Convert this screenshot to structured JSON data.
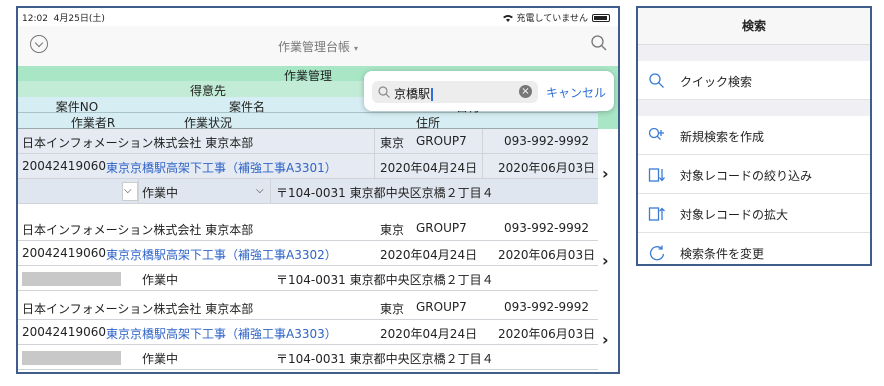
{
  "status_bar": {
    "time": "12:02",
    "date": "4月25日(土)",
    "charging": "充電していません"
  },
  "navbar": {
    "title": "作業管理台帳",
    "title_caret": "▾"
  },
  "table_header": {
    "group": "作業管理",
    "customer": "得意先",
    "case_no": "案件NO",
    "case_name": "案件名",
    "date": "日付",
    "worker": "作業者R",
    "work_status": "作業状況",
    "address": "住所"
  },
  "records": [
    {
      "customer": "日本インフォメーション株式会社 東京本部",
      "region": "東京",
      "group": "GROUP7",
      "phone": "093-992-9992",
      "case_no": "20042419060",
      "case_name": "東京京橋駅高架下工事（補強工事A3301）",
      "start_date": "2020年04月24日",
      "end_date": "2020年06月03日",
      "status": "作業中",
      "address": "〒104-0031 東京都中央区京橋２丁目４",
      "selected": true
    },
    {
      "customer": "日本インフォメーション株式会社 東京本部",
      "region": "東京",
      "group": "GROUP7",
      "phone": "093-992-9992",
      "case_no": "20042419060",
      "case_name": "東京京橋駅高架下工事（補強工事A3302）",
      "start_date": "2020年04月24日",
      "end_date": "2020年06月03日",
      "status": "作業中",
      "address": "〒104-0031 東京都中央区京橋２丁目４",
      "selected": false
    },
    {
      "customer": "日本インフォメーション株式会社 東京本部",
      "region": "東京",
      "group": "GROUP7",
      "phone": "093-992-9992",
      "case_no": "20042419060",
      "case_name": "東京京橋駅高架下工事（補強工事A3303）",
      "start_date": "2020年04月24日",
      "end_date": "2020年06月03日",
      "status": "作業中",
      "address": "〒104-0031 東京都中央区京橋２丁目４",
      "selected": false
    }
  ],
  "search_popup": {
    "value": "京橋駅",
    "cancel_label": "キャンセル"
  },
  "search_panel": {
    "title": "検索",
    "quick_search": "クイック検索",
    "items": [
      {
        "icon": "new-search-icon",
        "label": "新規検索を作成"
      },
      {
        "icon": "narrow-records-icon",
        "label": "対象レコードの絞り込み"
      },
      {
        "icon": "expand-records-icon",
        "label": "対象レコードの拡大"
      },
      {
        "icon": "refresh-icon",
        "label": "検索条件を変更"
      }
    ]
  },
  "colors": {
    "link": "#2e63c7",
    "header_green": "#a8e6c6",
    "header_blue": "#d6eef3",
    "frame": "#3f5d8a"
  }
}
